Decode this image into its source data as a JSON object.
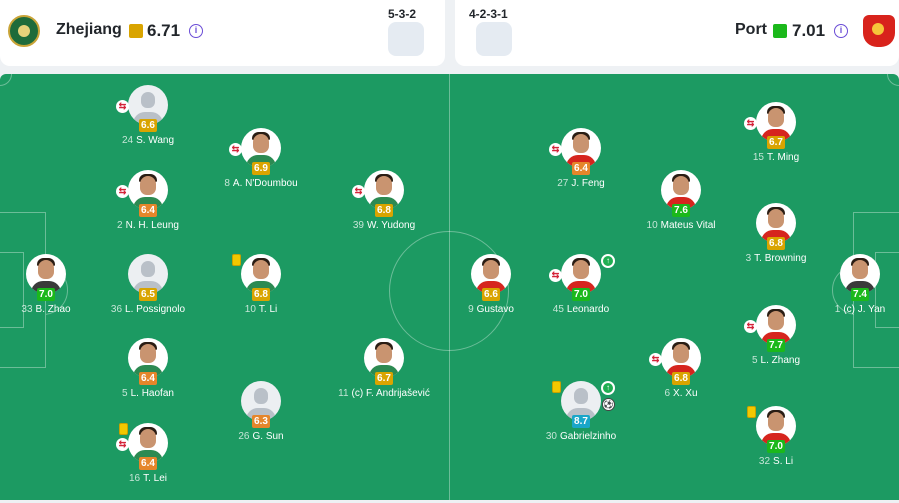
{
  "home": {
    "name": "Zhejiang",
    "rating": "6.71",
    "formation": "5-3-2",
    "crest_icon": "zhejiang-crest-icon"
  },
  "away": {
    "name": "Port",
    "rating": "7.01",
    "formation": "4-2-3-1",
    "crest_icon": "shanghai-port-crest-icon"
  },
  "colors": {
    "pitch": "#1c9a62",
    "rating_green": "#1bb81b",
    "rating_orange": "#e5862b",
    "rating_yellow": "#d9a400",
    "rating_blue": "#19a6c9"
  },
  "players": [
    {
      "id": "p1",
      "num": "24",
      "name": "S. Wang",
      "rating": "6.6",
      "tier": "yellow",
      "photo": "silhouette",
      "sub": true,
      "card": false,
      "goal": false,
      "ball": false
    },
    {
      "id": "p2",
      "num": "8",
      "name": "A. N'Doumbou",
      "rating": "6.9",
      "tier": "yellow",
      "photo": "photo",
      "sub": true,
      "card": false,
      "goal": false,
      "ball": false
    },
    {
      "id": "p3",
      "num": "2",
      "name": "N. H. Leung",
      "rating": "6.4",
      "tier": "orange",
      "photo": "photo",
      "sub": true,
      "card": false,
      "goal": false,
      "ball": false
    },
    {
      "id": "p4",
      "num": "39",
      "name": "W. Yudong",
      "rating": "6.8",
      "tier": "yellow",
      "photo": "photo",
      "sub": true,
      "card": false,
      "goal": false,
      "ball": false
    },
    {
      "id": "p5",
      "num": "33",
      "name": "B. Zhao",
      "rating": "7.0",
      "tier": "green",
      "photo": "photo-gk",
      "sub": false,
      "card": false,
      "goal": false,
      "ball": false
    },
    {
      "id": "p6",
      "num": "36",
      "name": "L. Possignolo",
      "rating": "6.5",
      "tier": "yellow",
      "photo": "silhouette",
      "sub": false,
      "card": false,
      "goal": false,
      "ball": false
    },
    {
      "id": "p7",
      "num": "10",
      "name": "T. Li",
      "rating": "6.8",
      "tier": "yellow",
      "photo": "photo",
      "sub": false,
      "card": true,
      "goal": false,
      "ball": false
    },
    {
      "id": "p8",
      "num": "5",
      "name": "L. Haofan",
      "rating": "6.4",
      "tier": "orange",
      "photo": "photo",
      "sub": false,
      "card": false,
      "goal": false,
      "ball": false
    },
    {
      "id": "p9",
      "num": "11",
      "name": "(c) F. Andrijašević",
      "rating": "6.7",
      "tier": "yellow",
      "photo": "photo",
      "sub": false,
      "card": false,
      "goal": false,
      "ball": false
    },
    {
      "id": "p10",
      "num": "26",
      "name": "G. Sun",
      "rating": "6.3",
      "tier": "orange",
      "photo": "silhouette",
      "sub": false,
      "card": false,
      "goal": false,
      "ball": false
    },
    {
      "id": "p11",
      "num": "16",
      "name": "T. Lei",
      "rating": "6.4",
      "tier": "orange",
      "photo": "photo",
      "sub": true,
      "card": true,
      "goal": false,
      "ball": false
    },
    {
      "id": "p12",
      "num": "27",
      "name": "J. Feng",
      "rating": "6.4",
      "tier": "orange",
      "photo": "photo-away",
      "sub": true,
      "card": false,
      "goal": false,
      "ball": false
    },
    {
      "id": "p13",
      "num": "10",
      "name": "Mateus Vital",
      "rating": "7.6",
      "tier": "green",
      "photo": "photo-away",
      "sub": false,
      "card": false,
      "goal": false,
      "ball": false
    },
    {
      "id": "p14",
      "num": "9",
      "name": "Gustavo",
      "rating": "6.6",
      "tier": "yellow",
      "photo": "photo-away",
      "sub": false,
      "card": false,
      "goal": false,
      "ball": false
    },
    {
      "id": "p15",
      "num": "45",
      "name": "Leonardo",
      "rating": "7.0",
      "tier": "green",
      "photo": "photo-away",
      "sub": true,
      "card": false,
      "goal": true,
      "ball": false
    },
    {
      "id": "p16",
      "num": "30",
      "name": "Gabrielzinho",
      "rating": "8.7",
      "tier": "blue",
      "photo": "silhouette",
      "sub": false,
      "card": true,
      "goal": true,
      "ball": true
    },
    {
      "id": "p17",
      "num": "15",
      "name": "T. Ming",
      "rating": "6.7",
      "tier": "yellow",
      "photo": "photo-away",
      "sub": true,
      "card": false,
      "goal": false,
      "ball": false
    },
    {
      "id": "p18",
      "num": "3",
      "name": "T. Browning",
      "rating": "6.8",
      "tier": "yellow",
      "photo": "photo-away",
      "sub": false,
      "card": false,
      "goal": false,
      "ball": false
    },
    {
      "id": "p19",
      "num": "5",
      "name": "L. Zhang",
      "rating": "7.7",
      "tier": "green",
      "photo": "photo-away",
      "sub": true,
      "card": false,
      "goal": false,
      "ball": false
    },
    {
      "id": "p20",
      "num": "6",
      "name": "X. Xu",
      "rating": "6.8",
      "tier": "yellow",
      "photo": "photo-away",
      "sub": true,
      "card": false,
      "goal": false,
      "ball": false
    },
    {
      "id": "p21",
      "num": "32",
      "name": "S. Li",
      "rating": "7.0",
      "tier": "green",
      "photo": "photo-away",
      "sub": false,
      "card": true,
      "goal": false,
      "ball": false
    },
    {
      "id": "p22",
      "num": "1",
      "name": "(c) J. Yan",
      "rating": "7.4",
      "tier": "green",
      "photo": "photo-gk",
      "sub": false,
      "card": false,
      "goal": false,
      "ball": false
    }
  ]
}
